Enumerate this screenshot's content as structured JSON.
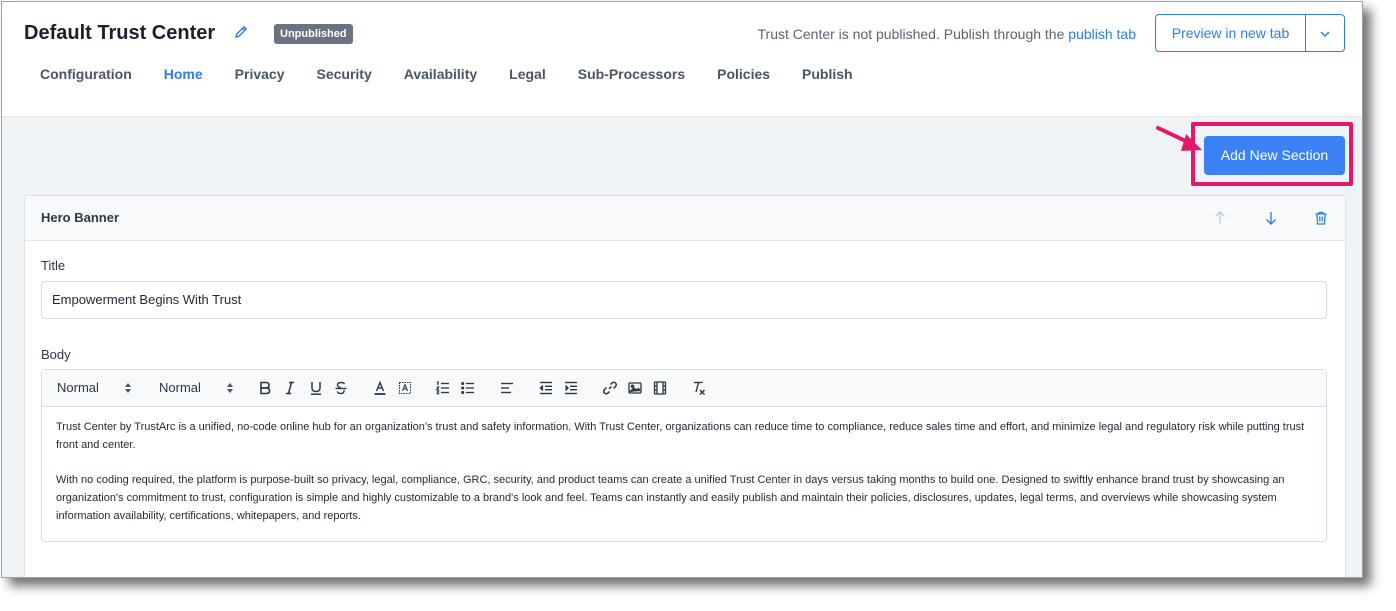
{
  "header": {
    "title": "Default Trust Center",
    "badge": "Unpublished",
    "notice_text": "Trust Center is not published. Publish through the",
    "notice_link": "publish tab",
    "preview_label": "Preview in new tab"
  },
  "tabs": [
    {
      "label": "Configuration",
      "active": false
    },
    {
      "label": "Home",
      "active": true
    },
    {
      "label": "Privacy",
      "active": false
    },
    {
      "label": "Security",
      "active": false
    },
    {
      "label": "Availability",
      "active": false
    },
    {
      "label": "Legal",
      "active": false
    },
    {
      "label": "Sub-Processors",
      "active": false
    },
    {
      "label": "Policies",
      "active": false
    },
    {
      "label": "Publish",
      "active": false
    }
  ],
  "actions": {
    "add_section_label": "Add New Section"
  },
  "section": {
    "title": "Hero Banner",
    "title_field_label": "Title",
    "title_value": "Empowerment Begins With Trust",
    "body_field_label": "Body",
    "toolbar": {
      "header_select": "Normal",
      "size_select": "Normal",
      "tools": [
        "bold-icon",
        "italic-icon",
        "underline-icon",
        "strike-icon",
        "text-color-icon",
        "highlight-icon",
        "ordered-list-icon",
        "bullet-list-icon",
        "align-icon",
        "outdent-icon",
        "indent-icon",
        "link-icon",
        "image-icon",
        "video-icon",
        "clear-format-icon"
      ]
    },
    "body_paragraphs": [
      "Trust Center by TrustArc is a unified, no-code online hub for an organization's trust and safety information. With Trust Center, organizations can reduce time to compliance, reduce sales time and effort, and minimize legal and regulatory risk while putting trust front and center.",
      "With no coding required, the platform is purpose-built so privacy, legal, compliance, GRC, security, and product teams can create a unified Trust Center in days versus taking months to build one. Designed to swiftly enhance brand trust by showcasing an organization's commitment to trust, configuration is simple and highly customizable to a brand's look and feel. Teams can instantly and easily publish and maintain their policies, disclosures, updates, legal terms, and overviews while showcasing system information availability, certifications, whitepapers, and reports."
    ]
  },
  "colors": {
    "accent": "#2f7fe0",
    "primary_button": "#3b82f6",
    "highlight": "#e5176b",
    "badge": "#6b7280"
  }
}
